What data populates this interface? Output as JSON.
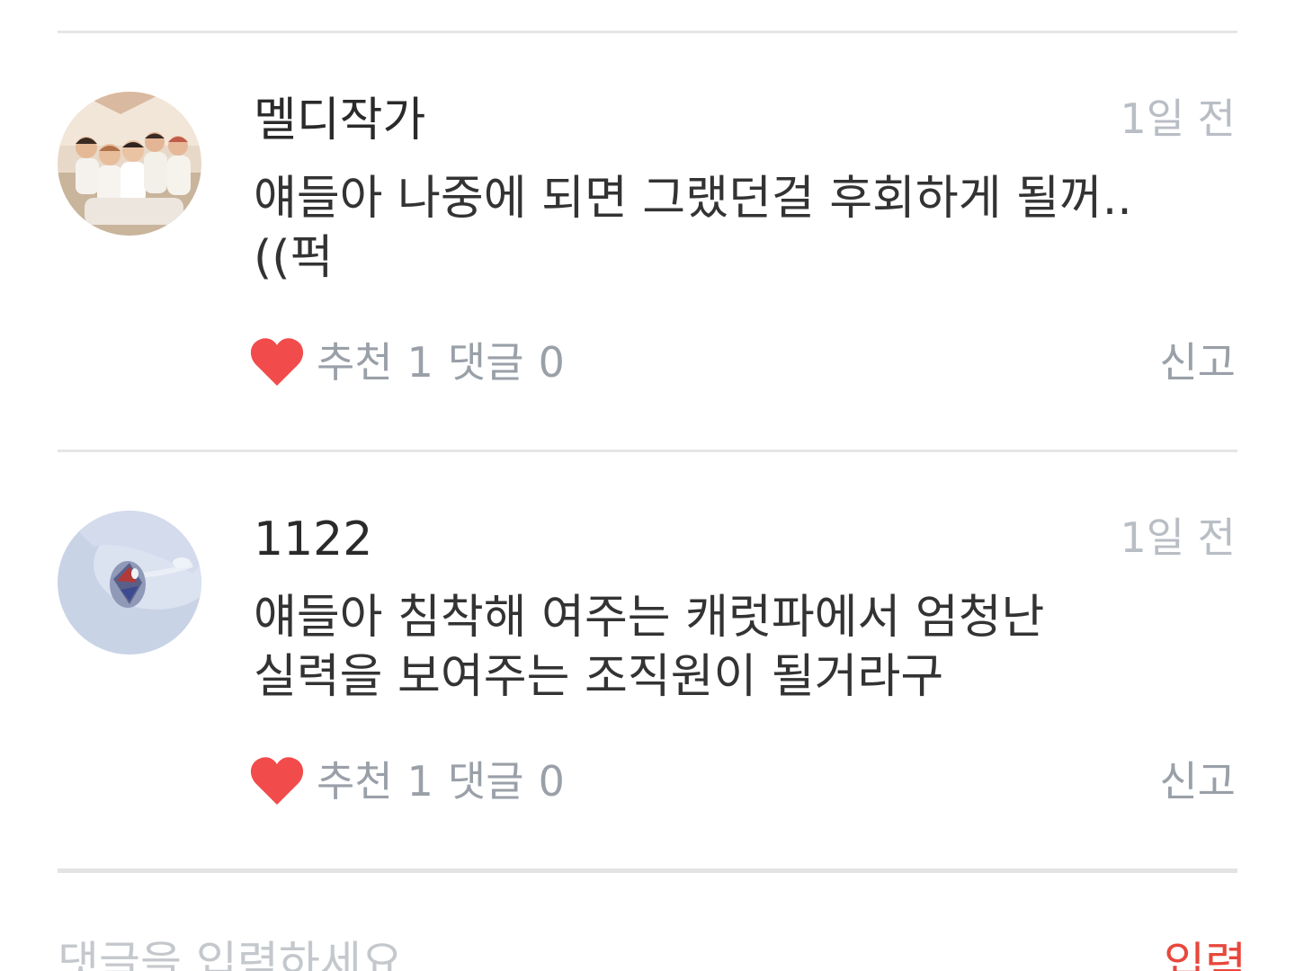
{
  "comments": [
    {
      "author": "멜디작가",
      "time": "1일 전",
      "body": "얘들아 나중에 되면 그랬던걸 후회하게 될꺼..\n((퍽",
      "like_label": "추천",
      "like_count": "1",
      "reply_label": "댓글",
      "reply_count": "0",
      "report_label": "신고",
      "avatar_icon": "group-photo-avatar"
    },
    {
      "author": "1122",
      "time": "1일 전",
      "body": "얘들아 침착해 여주는 캐럿파에서 엄청난\n실력을 보여주는 조직원이 될거라구",
      "like_label": "추천",
      "like_count": "1",
      "reply_label": "댓글",
      "reply_count": "0",
      "report_label": "신고",
      "avatar_icon": "gem-photo-avatar"
    }
  ],
  "input": {
    "placeholder": "댓글을 입력하세요",
    "submit_label": "입력"
  },
  "colors": {
    "heart": "#f24b4b",
    "submit": "#e8473b",
    "muted": "#9aa0a8"
  }
}
